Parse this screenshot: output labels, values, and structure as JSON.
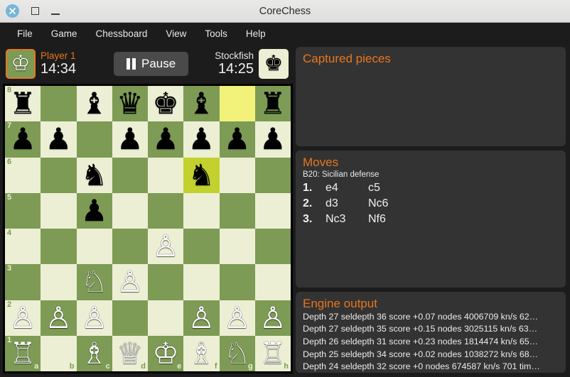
{
  "window": {
    "title": "CoreChess",
    "controls": {
      "close": "close-icon",
      "maximize": "maximize-icon",
      "minimize": "minimize-icon"
    }
  },
  "menubar": {
    "items": [
      {
        "label": "File"
      },
      {
        "label": "Game"
      },
      {
        "label": "Chessboard"
      },
      {
        "label": "View"
      },
      {
        "label": "Tools"
      },
      {
        "label": "Help"
      }
    ]
  },
  "playerbar": {
    "player1": {
      "name": "Player 1",
      "time": "14:34",
      "piece": "white-king",
      "active": true
    },
    "player2": {
      "name": "Stockfish",
      "time": "14:25",
      "piece": "black-king",
      "active": false
    },
    "pause_label": "Pause"
  },
  "board": {
    "files": [
      "a",
      "b",
      "c",
      "d",
      "e",
      "f",
      "g",
      "h"
    ],
    "ranks": [
      "8",
      "7",
      "6",
      "5",
      "4",
      "3",
      "2",
      "1"
    ],
    "highlight_from": "g8",
    "highlight_to": "f6",
    "colors": {
      "light": "#ecefd4",
      "dark": "#7d9b54",
      "highlight_from": "#f2f27a",
      "highlight_to": "#c3d12e"
    },
    "rows": [
      [
        {
          "sq": "a8",
          "piece": "black-rook",
          "glyph": "♜",
          "color": "black"
        },
        {
          "sq": "b8",
          "piece": null,
          "glyph": "",
          "color": null
        },
        {
          "sq": "c8",
          "piece": "black-bishop",
          "glyph": "♝",
          "color": "black"
        },
        {
          "sq": "d8",
          "piece": "black-queen",
          "glyph": "♛",
          "color": "black"
        },
        {
          "sq": "e8",
          "piece": "black-king",
          "glyph": "♚",
          "color": "black"
        },
        {
          "sq": "f8",
          "piece": "black-bishop",
          "glyph": "♝",
          "color": "black"
        },
        {
          "sq": "g8",
          "piece": null,
          "glyph": "",
          "color": null
        },
        {
          "sq": "h8",
          "piece": "black-rook",
          "glyph": "♜",
          "color": "black"
        }
      ],
      [
        {
          "sq": "a7",
          "piece": "black-pawn",
          "glyph": "♟",
          "color": "black"
        },
        {
          "sq": "b7",
          "piece": "black-pawn",
          "glyph": "♟",
          "color": "black"
        },
        {
          "sq": "c7",
          "piece": null,
          "glyph": "",
          "color": null
        },
        {
          "sq": "d7",
          "piece": "black-pawn",
          "glyph": "♟",
          "color": "black"
        },
        {
          "sq": "e7",
          "piece": "black-pawn",
          "glyph": "♟",
          "color": "black"
        },
        {
          "sq": "f7",
          "piece": "black-pawn",
          "glyph": "♟",
          "color": "black"
        },
        {
          "sq": "g7",
          "piece": "black-pawn",
          "glyph": "♟",
          "color": "black"
        },
        {
          "sq": "h7",
          "piece": "black-pawn",
          "glyph": "♟",
          "color": "black"
        }
      ],
      [
        {
          "sq": "a6",
          "piece": null,
          "glyph": "",
          "color": null
        },
        {
          "sq": "b6",
          "piece": null,
          "glyph": "",
          "color": null
        },
        {
          "sq": "c6",
          "piece": "black-knight",
          "glyph": "♞",
          "color": "black"
        },
        {
          "sq": "d6",
          "piece": null,
          "glyph": "",
          "color": null
        },
        {
          "sq": "e6",
          "piece": null,
          "glyph": "",
          "color": null
        },
        {
          "sq": "f6",
          "piece": "black-knight",
          "glyph": "♞",
          "color": "black"
        },
        {
          "sq": "g6",
          "piece": null,
          "glyph": "",
          "color": null
        },
        {
          "sq": "h6",
          "piece": null,
          "glyph": "",
          "color": null
        }
      ],
      [
        {
          "sq": "a5",
          "piece": null,
          "glyph": "",
          "color": null
        },
        {
          "sq": "b5",
          "piece": null,
          "glyph": "",
          "color": null
        },
        {
          "sq": "c5",
          "piece": "black-pawn",
          "glyph": "♟",
          "color": "black"
        },
        {
          "sq": "d5",
          "piece": null,
          "glyph": "",
          "color": null
        },
        {
          "sq": "e5",
          "piece": null,
          "glyph": "",
          "color": null
        },
        {
          "sq": "f5",
          "piece": null,
          "glyph": "",
          "color": null
        },
        {
          "sq": "g5",
          "piece": null,
          "glyph": "",
          "color": null
        },
        {
          "sq": "h5",
          "piece": null,
          "glyph": "",
          "color": null
        }
      ],
      [
        {
          "sq": "a4",
          "piece": null,
          "glyph": "",
          "color": null
        },
        {
          "sq": "b4",
          "piece": null,
          "glyph": "",
          "color": null
        },
        {
          "sq": "c4",
          "piece": null,
          "glyph": "",
          "color": null
        },
        {
          "sq": "d4",
          "piece": null,
          "glyph": "",
          "color": null
        },
        {
          "sq": "e4",
          "piece": "white-pawn",
          "glyph": "♙",
          "color": "white"
        },
        {
          "sq": "f4",
          "piece": null,
          "glyph": "",
          "color": null
        },
        {
          "sq": "g4",
          "piece": null,
          "glyph": "",
          "color": null
        },
        {
          "sq": "h4",
          "piece": null,
          "glyph": "",
          "color": null
        }
      ],
      [
        {
          "sq": "a3",
          "piece": null,
          "glyph": "",
          "color": null
        },
        {
          "sq": "b3",
          "piece": null,
          "glyph": "",
          "color": null
        },
        {
          "sq": "c3",
          "piece": "white-knight",
          "glyph": "♘",
          "color": "white"
        },
        {
          "sq": "d3",
          "piece": "white-pawn",
          "glyph": "♙",
          "color": "white"
        },
        {
          "sq": "e3",
          "piece": null,
          "glyph": "",
          "color": null
        },
        {
          "sq": "f3",
          "piece": null,
          "glyph": "",
          "color": null
        },
        {
          "sq": "g3",
          "piece": null,
          "glyph": "",
          "color": null
        },
        {
          "sq": "h3",
          "piece": null,
          "glyph": "",
          "color": null
        }
      ],
      [
        {
          "sq": "a2",
          "piece": "white-pawn",
          "glyph": "♙",
          "color": "white"
        },
        {
          "sq": "b2",
          "piece": "white-pawn",
          "glyph": "♙",
          "color": "white"
        },
        {
          "sq": "c2",
          "piece": "white-pawn",
          "glyph": "♙",
          "color": "white"
        },
        {
          "sq": "d2",
          "piece": null,
          "glyph": "",
          "color": null
        },
        {
          "sq": "e2",
          "piece": null,
          "glyph": "",
          "color": null
        },
        {
          "sq": "f2",
          "piece": "white-pawn",
          "glyph": "♙",
          "color": "white"
        },
        {
          "sq": "g2",
          "piece": "white-pawn",
          "glyph": "♙",
          "color": "white"
        },
        {
          "sq": "h2",
          "piece": "white-pawn",
          "glyph": "♙",
          "color": "white"
        }
      ],
      [
        {
          "sq": "a1",
          "piece": "white-rook",
          "glyph": "♖",
          "color": "white"
        },
        {
          "sq": "b1",
          "piece": null,
          "glyph": "",
          "color": null
        },
        {
          "sq": "c1",
          "piece": "white-bishop",
          "glyph": "♗",
          "color": "white"
        },
        {
          "sq": "d1",
          "piece": "white-queen",
          "glyph": "♕",
          "color": "white"
        },
        {
          "sq": "e1",
          "piece": "white-king",
          "glyph": "♔",
          "color": "white"
        },
        {
          "sq": "f1",
          "piece": "white-bishop",
          "glyph": "♗",
          "color": "white"
        },
        {
          "sq": "g1",
          "piece": "white-knight",
          "glyph": "♘",
          "color": "white"
        },
        {
          "sq": "h1",
          "piece": "white-rook",
          "glyph": "♖",
          "color": "white"
        }
      ]
    ]
  },
  "captured": {
    "title": "Captured pieces",
    "items": []
  },
  "moves": {
    "title": "Moves",
    "eco": "B20: Sicilian defense",
    "list": [
      {
        "num": "1.",
        "white": "e4",
        "black": "c5"
      },
      {
        "num": "2.",
        "white": "d3",
        "black": "Nc6"
      },
      {
        "num": "3.",
        "white": "Nc3",
        "black": "Nf6"
      }
    ]
  },
  "engine": {
    "title": "Engine output",
    "lines": [
      "Depth 27 seldepth 36 score +0.07 nodes 4006709 kn/s 62…",
      "Depth 27 seldepth 35 score +0.15 nodes 3025115 kn/s 63…",
      "Depth 26 seldepth 31 score +0.23 nodes 1814474 kn/s 65…",
      "Depth 25 seldepth 34 score +0.02 nodes 1038272 kn/s 68…",
      "Depth 24 seldepth 32 score +0 nodes 674587 kn/s 701 tim…"
    ]
  },
  "theme": {
    "accent": "#e8761f",
    "panel_bg": "#333333",
    "app_bg": "#1c1c1c"
  }
}
